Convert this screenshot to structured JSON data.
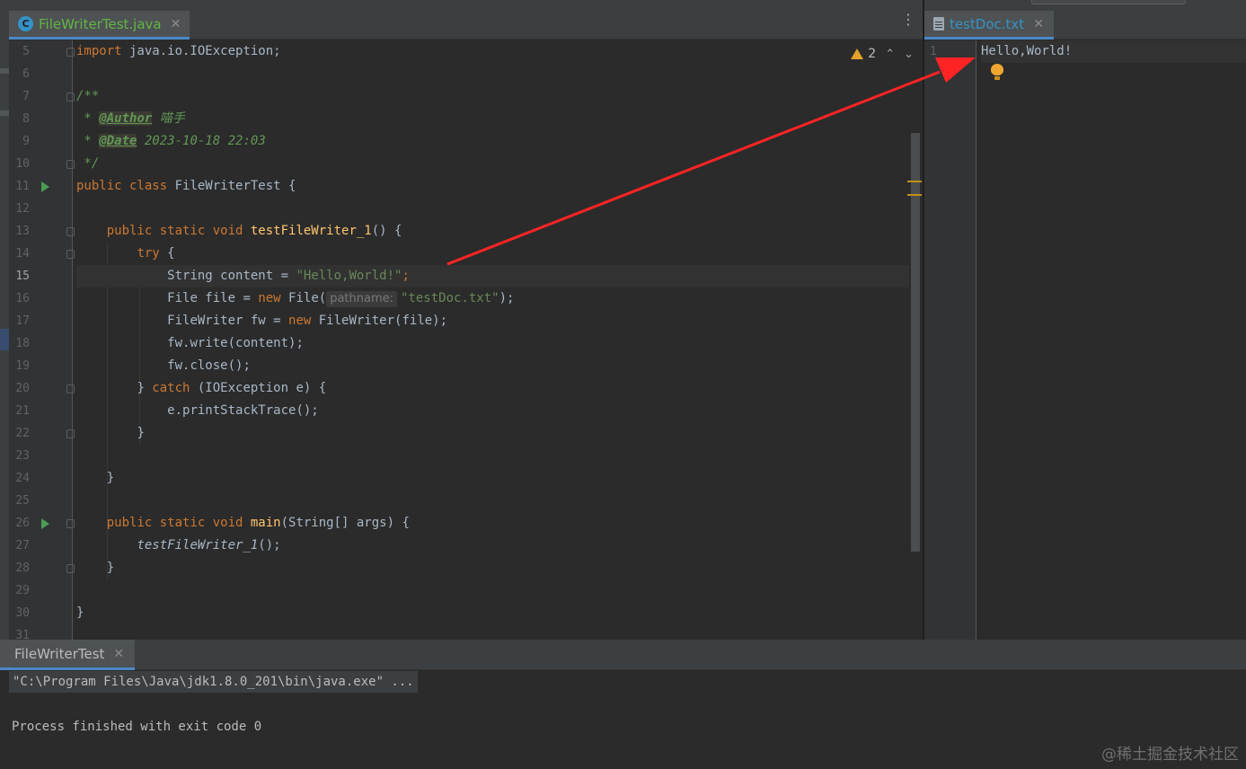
{
  "editor_left": {
    "tab": {
      "label": "FileWriterTest.java",
      "icon": "java-class-icon"
    },
    "inspection": {
      "warning_count": "2"
    },
    "lines": [
      {
        "n": "5"
      },
      {
        "n": "6"
      },
      {
        "n": "7"
      },
      {
        "n": "8"
      },
      {
        "n": "9"
      },
      {
        "n": "10"
      },
      {
        "n": "11"
      },
      {
        "n": "12"
      },
      {
        "n": "13"
      },
      {
        "n": "14"
      },
      {
        "n": "15"
      },
      {
        "n": "16"
      },
      {
        "n": "17"
      },
      {
        "n": "18"
      },
      {
        "n": "19"
      },
      {
        "n": "20"
      },
      {
        "n": "21"
      },
      {
        "n": "22"
      },
      {
        "n": "23"
      },
      {
        "n": "24"
      },
      {
        "n": "25"
      },
      {
        "n": "26"
      },
      {
        "n": "27"
      },
      {
        "n": "28"
      },
      {
        "n": "29"
      },
      {
        "n": "30"
      },
      {
        "n": "31"
      }
    ],
    "code": {
      "l5_kw": "import",
      "l5_rest": " java.io.IOException;",
      "l7": "/**",
      "l8_star": " * ",
      "l8_tag": "@Author",
      "l8_val": " 喵手",
      "l9_star": " * ",
      "l9_tag": "@Date",
      "l9_val": " 2023-10-18 22:03",
      "l10": " */",
      "l11_kw": "public class",
      "l11_rest": " FileWriterTest {",
      "l13_kw": "public static void",
      "l13_fn": "testFileWriter_1",
      "l13_rest": "() {",
      "l14_kw": "try",
      "l14_rest": " {",
      "l15_a": "String content = ",
      "l15_str": "\"Hello,World!\"",
      "l15_semi": ";",
      "l16_a": "File file = ",
      "l16_kw": "new",
      "l16_b": " File(",
      "l16_hint": "pathname:",
      "l16_str": "\"testDoc.txt\"",
      "l16_c": ");",
      "l17_a": "FileWriter fw = ",
      "l17_kw": "new",
      "l17_b": " FileWriter(file);",
      "l18": "fw.write(content);",
      "l19": "fw.close();",
      "l20_a": "} ",
      "l20_kw": "catch",
      "l20_b": " (IOException e) {",
      "l21": "e.printStackTrace();",
      "l22": "}",
      "l24": "}",
      "l26_kw": "public static void",
      "l26_fn": "main",
      "l26_rest": "(String[] args) {",
      "l27": "testFileWriter_1",
      "l27_rest": "();",
      "l28": "}",
      "l30": "}"
    }
  },
  "editor_right": {
    "tab": {
      "label": "testDoc.txt",
      "icon": "text-file-icon"
    },
    "line_number": "1",
    "content": "Hello,World!"
  },
  "run_panel": {
    "tab": {
      "label": "FileWriterTest"
    },
    "command": "\"C:\\Program Files\\Java\\jdk1.8.0_201\\bin\\java.exe\" ...",
    "exit": "Process finished with exit code 0"
  },
  "watermark": "@稀土掘金技术社区",
  "colors": {
    "background": "#2b2b2b",
    "keyword": "#cc7832",
    "string": "#6a8759",
    "function": "#ffc66d",
    "comment": "#629755",
    "arrow": "#ff2020",
    "accent_tab": "#4a88c7"
  }
}
